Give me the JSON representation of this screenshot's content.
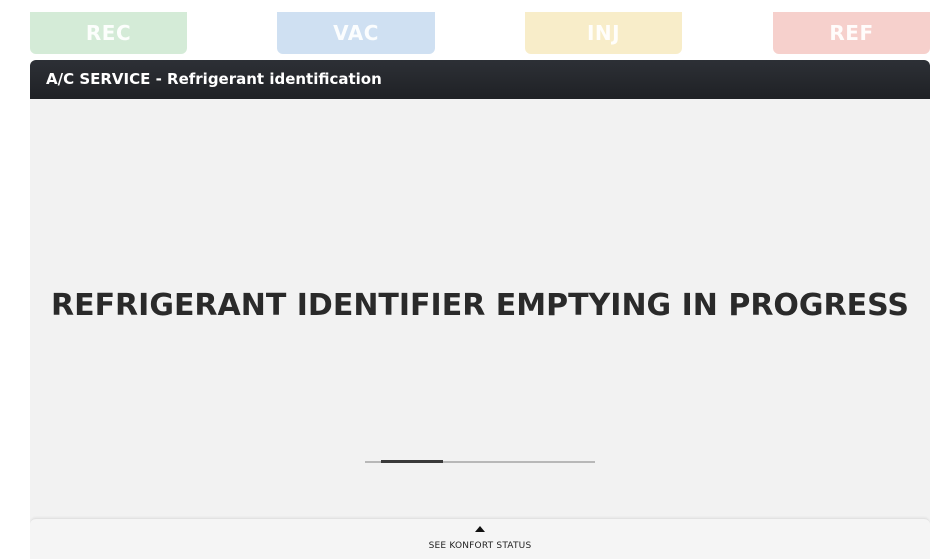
{
  "tabs": [
    {
      "label": "REC",
      "color": "#d4ebd7"
    },
    {
      "label": "VAC",
      "color": "#cfe0f2"
    },
    {
      "label": "INJ",
      "color": "#f8edc9"
    },
    {
      "label": "REF",
      "color": "#f6d0cc"
    }
  ],
  "panel": {
    "title": "A/C SERVICE - Refrigerant identification",
    "message": "REFRIGERANT IDENTIFIER EMPTYING IN PROGRESS",
    "progress": 0.27
  },
  "footer": {
    "label": "SEE KONFORT STATUS",
    "icon": "triangle-up-icon"
  }
}
